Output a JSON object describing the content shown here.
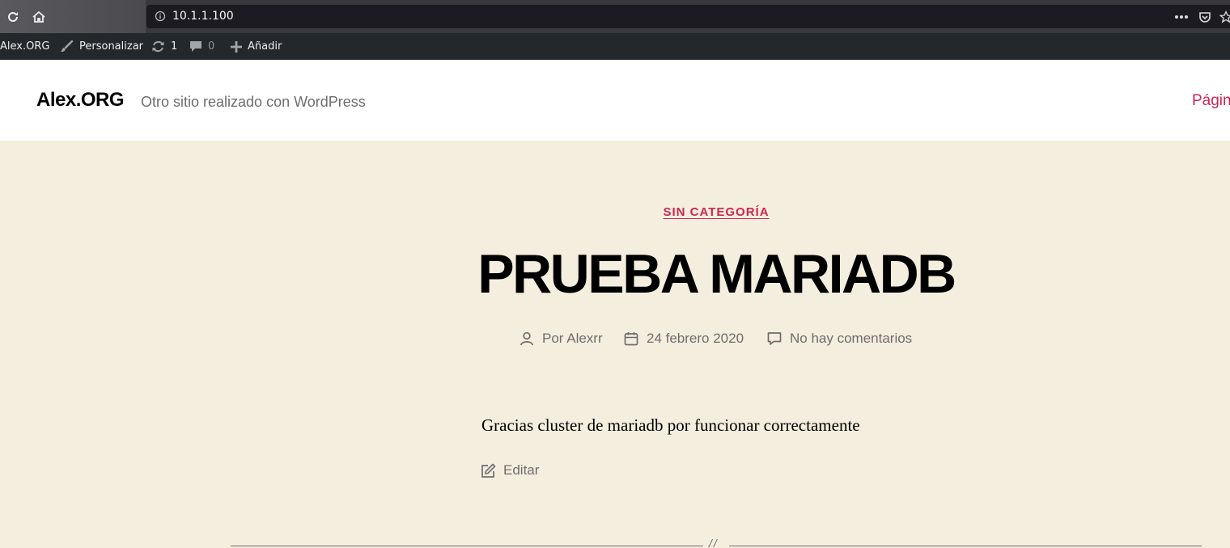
{
  "browser": {
    "url": "10.1.1.100",
    "icons": [
      "reload-icon",
      "home-icon",
      "info-icon",
      "more-icon",
      "pocket-icon",
      "bookmark-star-icon"
    ]
  },
  "admin_bar": {
    "site": "Alex.ORG",
    "customize": "Personalizar",
    "updates_count": "1",
    "comments_count": "0",
    "add_new": "Añadir"
  },
  "header": {
    "site_title": "Alex.ORG",
    "tagline": "Otro sitio realizado con WordPress",
    "menu_item": "Página"
  },
  "post": {
    "category": "SIN CATEGORÍA",
    "title": "PRUEBA MARIADB",
    "author": "Por Alexrr",
    "date": "24 febrero 2020",
    "comments": "No hay comentarios",
    "body": "Gracias cluster de mariadb por funcionar correctamente",
    "edit": "Editar"
  },
  "colors": {
    "accent": "#cd2653",
    "background": "#f4eede",
    "admin_bar": "#23282d",
    "text_muted": "#6d6d6d"
  }
}
